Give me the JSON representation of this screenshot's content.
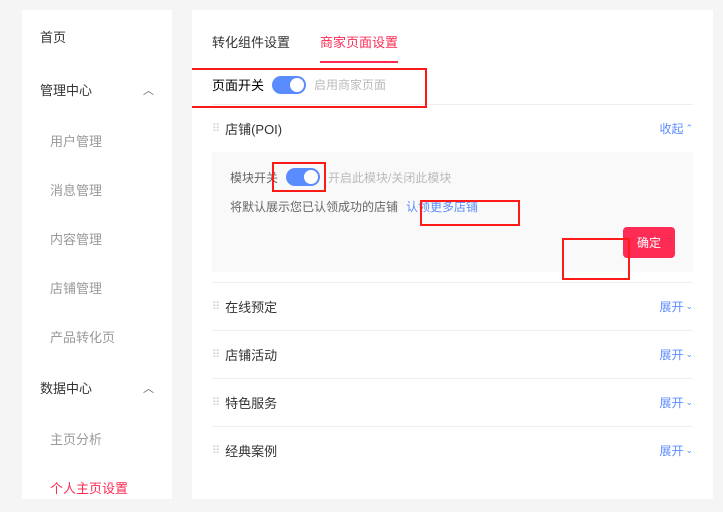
{
  "sidebar": {
    "home": "首页",
    "mgmt": "管理中心",
    "user_mgmt": "用户管理",
    "msg_mgmt": "消息管理",
    "content_mgmt": "内容管理",
    "store_mgmt": "店铺管理",
    "product_conv": "产品转化页",
    "data_center": "数据中心",
    "home_analysis": "主页分析",
    "profile_settings": "个人主页设置"
  },
  "tabs": {
    "conversion": "转化组件设置",
    "merchant": "商家页面设置"
  },
  "page_toggle": {
    "label": "页面开关",
    "hint": "启用商家页面"
  },
  "poi": {
    "title": "店铺(POI)",
    "collapse": "收起",
    "module_label": "模块开关",
    "module_hint": "开启此模块/关闭此模块",
    "default_text": "将默认展示您已认领成功的店铺",
    "claim_link": "认领更多店铺",
    "confirm": "确定"
  },
  "sections": {
    "booking": "在线预定",
    "activity": "店铺活动",
    "feature": "特色服务",
    "classic": "经典案例",
    "expand": "展开"
  }
}
